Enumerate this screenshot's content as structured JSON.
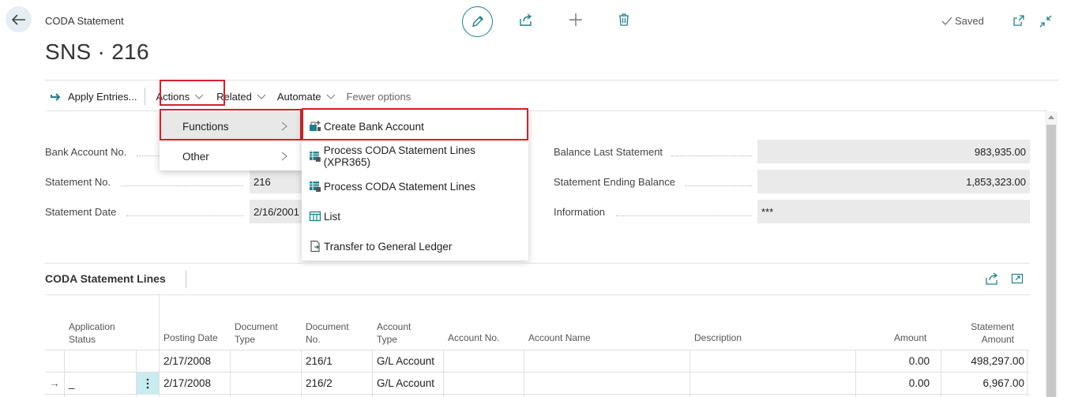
{
  "header": {
    "caption": "CODA Statement",
    "title": "SNS · 216",
    "saved_label": "Saved"
  },
  "actionbar": {
    "apply_entries": "Apply Entries...",
    "actions": "Actions",
    "related": "Related",
    "automate": "Automate",
    "fewer_options": "Fewer options"
  },
  "actions_menu": {
    "items": [
      {
        "label": "Functions",
        "selected": true
      },
      {
        "label": "Other",
        "selected": false
      }
    ]
  },
  "functions_menu": {
    "items": [
      {
        "label": "Create Bank Account",
        "icon": "create-account-icon"
      },
      {
        "label": "Process CODA Statement Lines (XPR365)",
        "icon": "process-lines-icon"
      },
      {
        "label": "Process CODA Statement Lines",
        "icon": "process-lines-icon"
      },
      {
        "label": "List",
        "icon": "list-icon"
      },
      {
        "label": "Transfer to General Ledger",
        "icon": "transfer-icon"
      }
    ]
  },
  "fields": {
    "bank_account_no_label": "Bank Account No.",
    "statement_no_label": "Statement No.",
    "statement_no_value": "216",
    "statement_date_label": "Statement Date",
    "statement_date_value": "2/16/2001",
    "balance_last_label": "Balance Last Statement",
    "balance_last_value": "983,935.00",
    "ending_balance_label": "Statement Ending Balance",
    "ending_balance_value": "1,853,323.00",
    "information_label": "Information",
    "information_value": "***"
  },
  "lines": {
    "title": "CODA Statement Lines",
    "columns": {
      "application_status": "Application Status",
      "posting_date": "Posting Date",
      "document_type": "Document Type",
      "document_no": "Document No.",
      "account_type": "Account Type",
      "account_no": "Account No.",
      "account_name": "Account Name",
      "description": "Description",
      "amount": "Amount",
      "statement_amount": "Statement Amount"
    },
    "rows": [
      {
        "marker": "",
        "application_status": "",
        "posting_date": "2/17/2008",
        "document_no": "216/1",
        "account_type": "G/L Account",
        "amount": "0.00",
        "statement_amount": "498,297.00"
      },
      {
        "marker": "→",
        "application_status": "_",
        "posting_date": "2/17/2008",
        "document_no": "216/2",
        "account_type": "G/L Account",
        "amount": "0.00",
        "statement_amount": "6,967.00"
      }
    ]
  },
  "colors": {
    "accent": "#1d7f8c",
    "highlight": "#d6202a"
  }
}
